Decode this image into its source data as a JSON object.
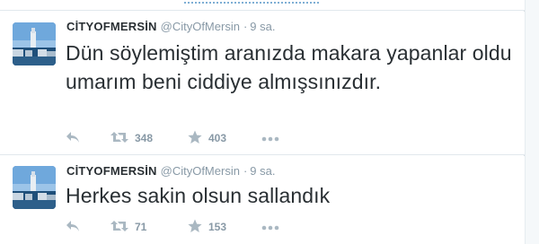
{
  "tweets": [
    {
      "fullname": "CİTYOFMERSİN",
      "username": "@CityOfMersin",
      "separator": "·",
      "time": "9 sa.",
      "text": "Dün söylemiştim aranızda makara yapanlar oldu umarım beni ciddiye almışsınızdır.",
      "retweets": "348",
      "favorites": "403"
    },
    {
      "fullname": "CİTYOFMERSİN",
      "username": "@CityOfMersin",
      "separator": "·",
      "time": "9 sa.",
      "text": "Herkes sakin olsun sallandık",
      "retweets": "71",
      "favorites": "153"
    }
  ],
  "icons": {
    "reply": "reply-icon",
    "retweet": "retweet-icon",
    "favorite": "star-icon",
    "more": "more-dots-icon"
  },
  "colors": {
    "text": "#292f33",
    "muted": "#8899a6",
    "icon": "#aab8c2",
    "link": "#2b7bb9"
  }
}
